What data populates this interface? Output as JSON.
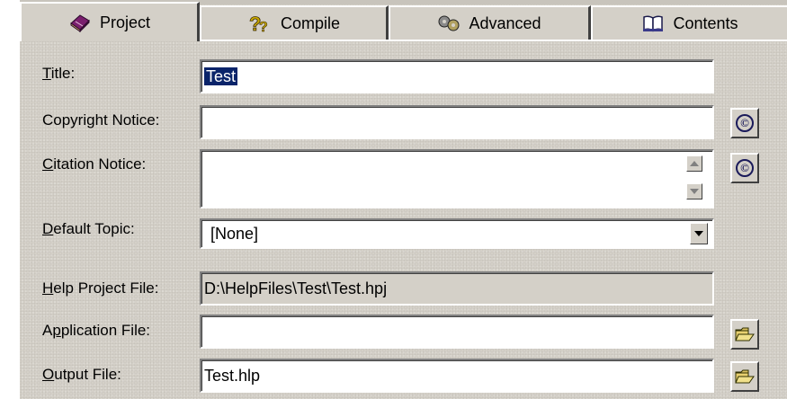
{
  "tabs": [
    {
      "label": "Project",
      "icon": "book-icon",
      "active": true
    },
    {
      "label": "Compile",
      "icon": "question-mark-icon",
      "active": false
    },
    {
      "label": "Advanced",
      "icon": "gears-icon",
      "active": false
    },
    {
      "label": "Contents",
      "icon": "open-book-icon",
      "active": false
    }
  ],
  "fields": {
    "title": {
      "label_u": "T",
      "label_rest": "itle:",
      "value": "Test"
    },
    "copyright": {
      "label": "Copyright Notice:",
      "value": "",
      "button_symbol": "©"
    },
    "citation": {
      "label_u": "C",
      "label_rest": "itation Notice:",
      "value": "",
      "button_symbol": "©"
    },
    "default_topic": {
      "label_u": "D",
      "label_rest": "efault Topic:",
      "value": "[None]"
    },
    "help_project_file": {
      "label_u": "H",
      "label_rest": "elp Project File:",
      "value": "D:\\HelpFiles\\Test\\Test.hpj"
    },
    "application_file": {
      "label_pre": "A",
      "label_u": "p",
      "label_rest": "plication File:",
      "value": ""
    },
    "output_file": {
      "label_u": "O",
      "label_rest": "utput File:",
      "value": "Test.hlp"
    }
  },
  "colors": {
    "face": "#d4d0c8",
    "selection": "#0a246a"
  }
}
